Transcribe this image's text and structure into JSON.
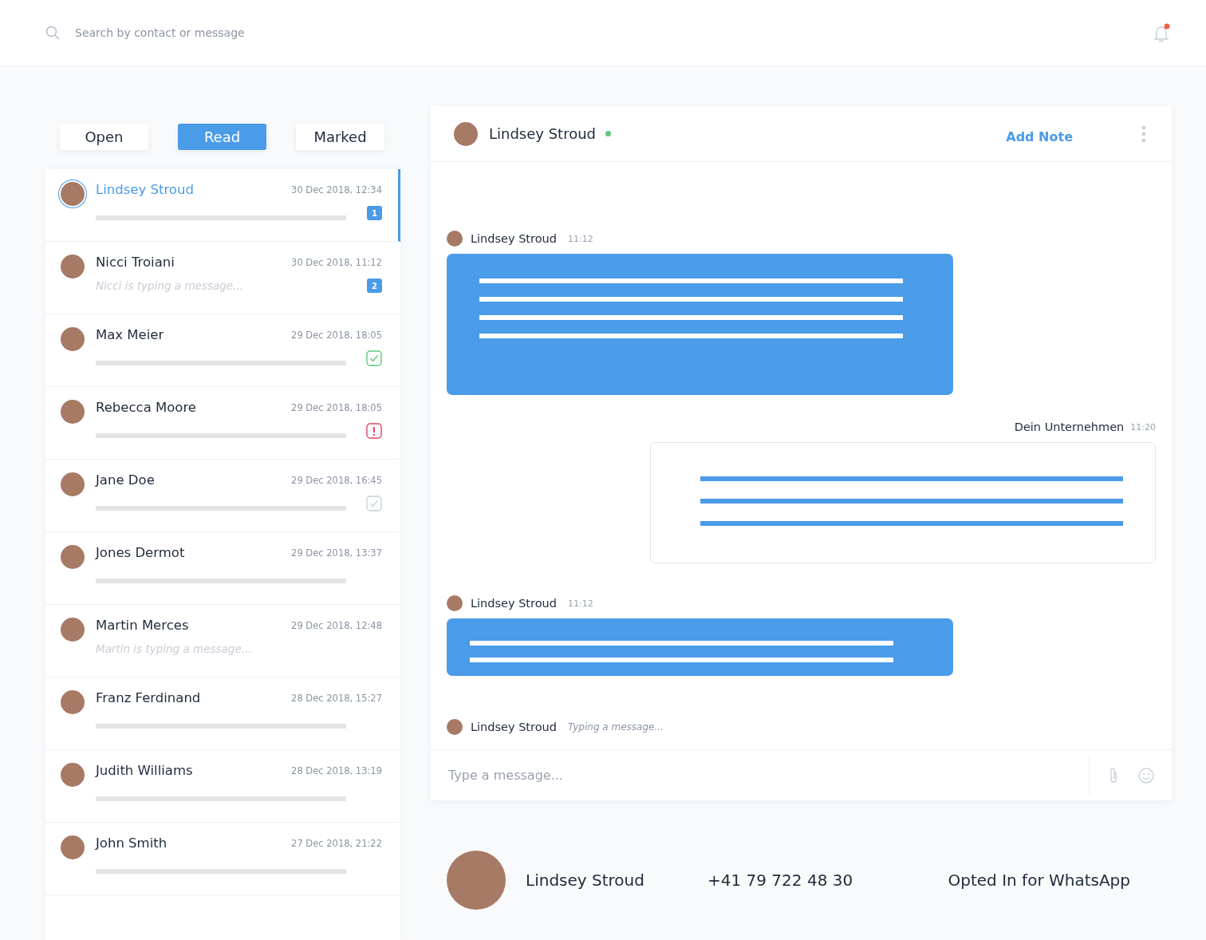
{
  "search": {
    "placeholder": "Search by contact or message"
  },
  "notifications": {
    "unread": true
  },
  "tabs": [
    {
      "label": "Open",
      "selected": false
    },
    {
      "label": "Read",
      "selected": true
    },
    {
      "label": "Marked",
      "selected": false
    }
  ],
  "conversations": [
    {
      "name": "Lindsey Stroud",
      "date": "30 Dec 2018, 12:34",
      "selected": true,
      "kind": "badge",
      "count": "1"
    },
    {
      "name": "Nicci Troiani",
      "date": "30 Dec 2018, 11:12",
      "selected": false,
      "typing": "Nicci is typing a message...",
      "kind": "badge",
      "count": "2"
    },
    {
      "name": "Max Meier",
      "date": "29 Dec 2018, 18:05",
      "selected": false,
      "kind": "done"
    },
    {
      "name": "Rebecca Moore",
      "date": "29 Dec 2018, 18:05",
      "selected": false,
      "kind": "alert"
    },
    {
      "name": "Jane Doe",
      "date": "29 Dec 2018, 16:45",
      "selected": false,
      "kind": "seen"
    },
    {
      "name": "Jones Dermot",
      "date": "29 Dec 2018, 13:37",
      "selected": false,
      "kind": "plain"
    },
    {
      "name": "Martin Merces",
      "date": "29 Dec 2018, 12:48",
      "selected": false,
      "typing": "Martin is typing a message...",
      "kind": "plain"
    },
    {
      "name": "Franz Ferdinand",
      "date": "28 Dec 2018, 15:27",
      "selected": false,
      "kind": "plain"
    },
    {
      "name": "Judith Williams",
      "date": "28 Dec 2018, 13:19",
      "selected": false,
      "kind": "plain"
    },
    {
      "name": "John Smith",
      "date": "27 Dec 2018, 21:22",
      "selected": false,
      "kind": "plain"
    }
  ],
  "chat": {
    "contact": "Lindsey Stroud",
    "online": true,
    "action": "Add Note",
    "messages": [
      {
        "kind": "long",
        "author": "Lindsey Stroud",
        "time": "11:12"
      },
      {
        "kind": "reply",
        "author": "Dein Unternehmen",
        "time": "11:20"
      },
      {
        "kind": "brief",
        "author": "Lindsey Stroud",
        "time": "11:12"
      }
    ],
    "typing": {
      "author": "Lindsey Stroud",
      "text": "Typing a message..."
    },
    "composer": {
      "placeholder": "Type a message..."
    }
  },
  "profile": {
    "name": "Lindsey Stroud",
    "phone": "+41 79 722 48 30",
    "whatsapp": "Opted In for WhatsApp"
  }
}
